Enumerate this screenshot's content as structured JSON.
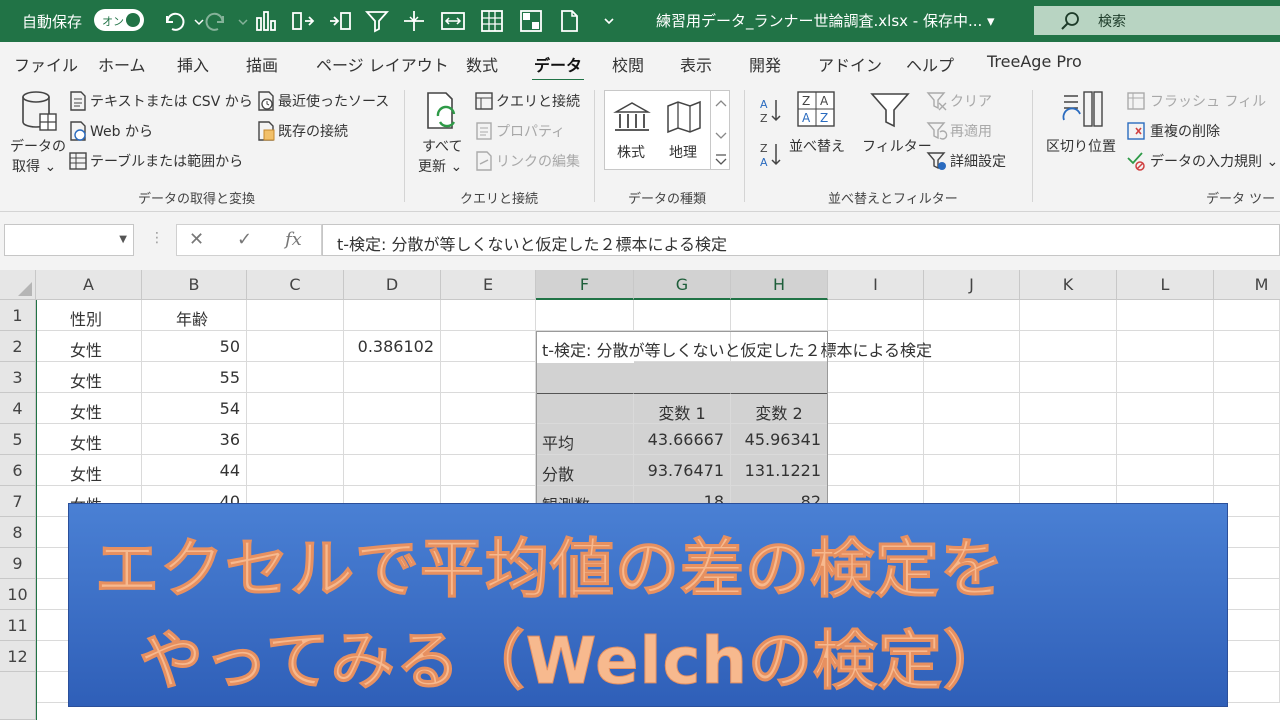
{
  "titlebar": {
    "autosave_label": "自動保存",
    "autosave_state": "オン",
    "document_title": "練習用データ_ランナー世論調査.xlsx - 保存中... ▾",
    "search_placeholder": "検索",
    "accent_color": "#217346"
  },
  "ribbon_tabs": [
    "ファイル",
    "ホーム",
    "挿入",
    "描画",
    "ページ レイアウト",
    "数式",
    "データ",
    "校閲",
    "表示",
    "開発",
    "アドイン",
    "ヘルプ",
    "TreeAge Pro"
  ],
  "ribbon_active_tab": "データ",
  "ribbon": {
    "get_data_line1": "データの",
    "get_data_line2": "取得 ⌄",
    "text_csv": "テキストまたは CSV から",
    "web": "Web から",
    "table_range": "テーブルまたは範囲から",
    "recent_sources": "最近使ったソース",
    "existing_connections": "既存の接続",
    "group_get_transform": "データの取得と変換",
    "refresh_line1": "すべて",
    "refresh_line2": "更新 ⌄",
    "queries_connections": "クエリと接続",
    "properties": "プロパティ",
    "edit_links": "リンクの編集",
    "group_queries": "クエリと接続",
    "stocks": "株式",
    "geography": "地理",
    "group_data_types": "データの種類",
    "sort": "並べ替え",
    "filter": "フィルター",
    "clear": "クリア",
    "reapply": "再適用",
    "advanced": "詳細設定",
    "group_sort_filter": "並べ替えとフィルター",
    "text_to_columns": "区切り位置",
    "flash_fill": "フラッシュ フィル",
    "remove_duplicates": "重複の削除",
    "data_validation": "データの入力規則  ⌄",
    "group_data_tools": "データ ツール"
  },
  "formula_bar": {
    "name_box": "",
    "cancel_symbol": "✕",
    "enter_symbol": "✓",
    "fx_symbol": "fx",
    "formula": "t-検定: 分散が等しくないと仮定した２標本による検定"
  },
  "grid": {
    "columns": [
      "A",
      "B",
      "C",
      "D",
      "E",
      "F",
      "G",
      "H",
      "I",
      "J",
      "K",
      "L",
      "M"
    ],
    "selected_columns": [
      "F",
      "G",
      "H"
    ],
    "rows": [
      "1",
      "2",
      "3",
      "4",
      "5",
      "6",
      "7",
      "8",
      "9",
      "10",
      "11",
      "12"
    ],
    "cells": {
      "A1": "性別",
      "B1": "年齢",
      "A2": "女性",
      "B2": "50",
      "D2": "0.386102",
      "F2": "t-検定: 分散が等しくないと仮定した２標本による検定",
      "A3": "女性",
      "B3": "55",
      "A4": "女性",
      "B4": "54",
      "G4": "変数 1",
      "H4": "変数 2",
      "A5": "女性",
      "B5": "36",
      "F5": "平均",
      "G5": "43.66667",
      "H5": "45.96341",
      "A6": "女性",
      "B6": "44",
      "F6": "分散",
      "G6": "93.76471",
      "H6": "131.1221",
      "A7": "女性",
      "B7": "40",
      "F7": "観測数",
      "G7": "18",
      "H7": "82"
    }
  },
  "banner": {
    "line1": "エクセルで平均値の差の検定を",
    "line2": "やってみる（Welchの検定）",
    "text_color": "#f7b98e",
    "background_color": "#3d6fc6"
  }
}
